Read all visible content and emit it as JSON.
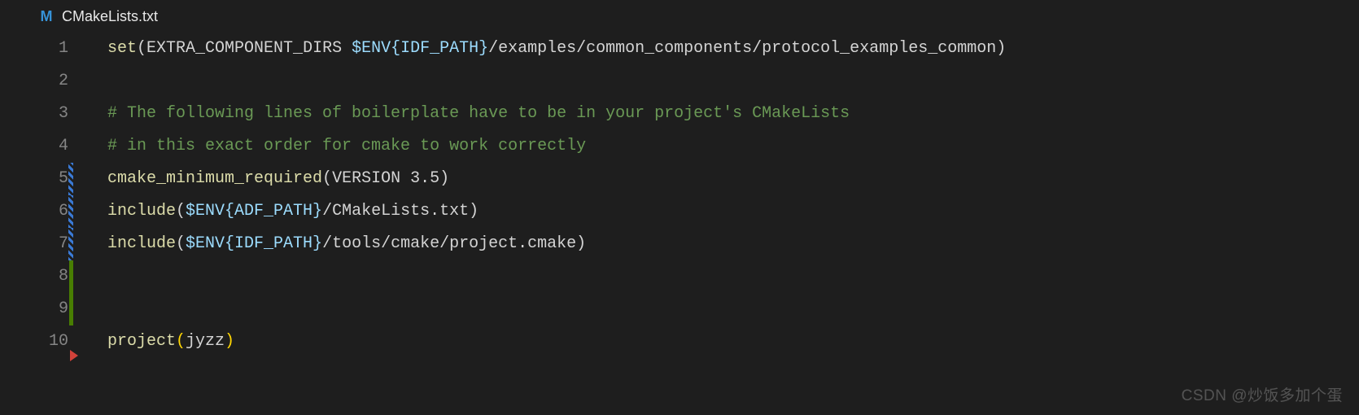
{
  "tab": {
    "icon_letter": "M",
    "filename": "CMakeLists.txt"
  },
  "gutter": {
    "numbers": [
      "1",
      "2",
      "3",
      "4",
      "5",
      "6",
      "7",
      "8",
      "9",
      "10"
    ],
    "diff_markers": {
      "5": "hatch",
      "6": "hatch",
      "7": "hatch",
      "8": "green",
      "9": "green"
    },
    "breakpoint_after": "10"
  },
  "code": {
    "lines": [
      [
        {
          "c": "tok-fn",
          "t": "set"
        },
        {
          "c": "tok-punc",
          "t": "("
        },
        {
          "c": "tok-txt",
          "t": "EXTRA_COMPONENT_DIRS "
        },
        {
          "c": "tok-var",
          "t": "$ENV{IDF_PATH}"
        },
        {
          "c": "tok-txt",
          "t": "/examples/common_components/protocol_examples_common"
        },
        {
          "c": "tok-punc",
          "t": ")"
        }
      ],
      [],
      [
        {
          "c": "tok-cmt",
          "t": "# The following lines of boilerplate have to be in your project's CMakeLists"
        }
      ],
      [
        {
          "c": "tok-cmt",
          "t": "# in this exact order for cmake to work correctly"
        }
      ],
      [
        {
          "c": "tok-fn",
          "t": "cmake_minimum_required"
        },
        {
          "c": "tok-punc",
          "t": "("
        },
        {
          "c": "tok-txt",
          "t": "VERSION 3.5"
        },
        {
          "c": "tok-punc",
          "t": ")"
        }
      ],
      [
        {
          "c": "tok-fn",
          "t": "include"
        },
        {
          "c": "tok-punc",
          "t": "("
        },
        {
          "c": "tok-var",
          "t": "$ENV{ADF_PATH}"
        },
        {
          "c": "tok-txt",
          "t": "/CMakeLists.txt"
        },
        {
          "c": "tok-punc",
          "t": ")"
        }
      ],
      [
        {
          "c": "tok-fn",
          "t": "include"
        },
        {
          "c": "tok-punc",
          "t": "("
        },
        {
          "c": "tok-var",
          "t": "$ENV{IDF_PATH}"
        },
        {
          "c": "tok-txt",
          "t": "/tools/cmake/project.cmake"
        },
        {
          "c": "tok-punc",
          "t": ")"
        }
      ],
      [],
      [],
      [
        {
          "c": "tok-fn",
          "t": "project"
        },
        {
          "c": "tok-pbr",
          "t": "("
        },
        {
          "c": "tok-txt",
          "t": "jyzz"
        },
        {
          "c": "tok-pbr",
          "t": ")"
        }
      ]
    ]
  },
  "watermark": "CSDN @炒饭多加个蛋"
}
